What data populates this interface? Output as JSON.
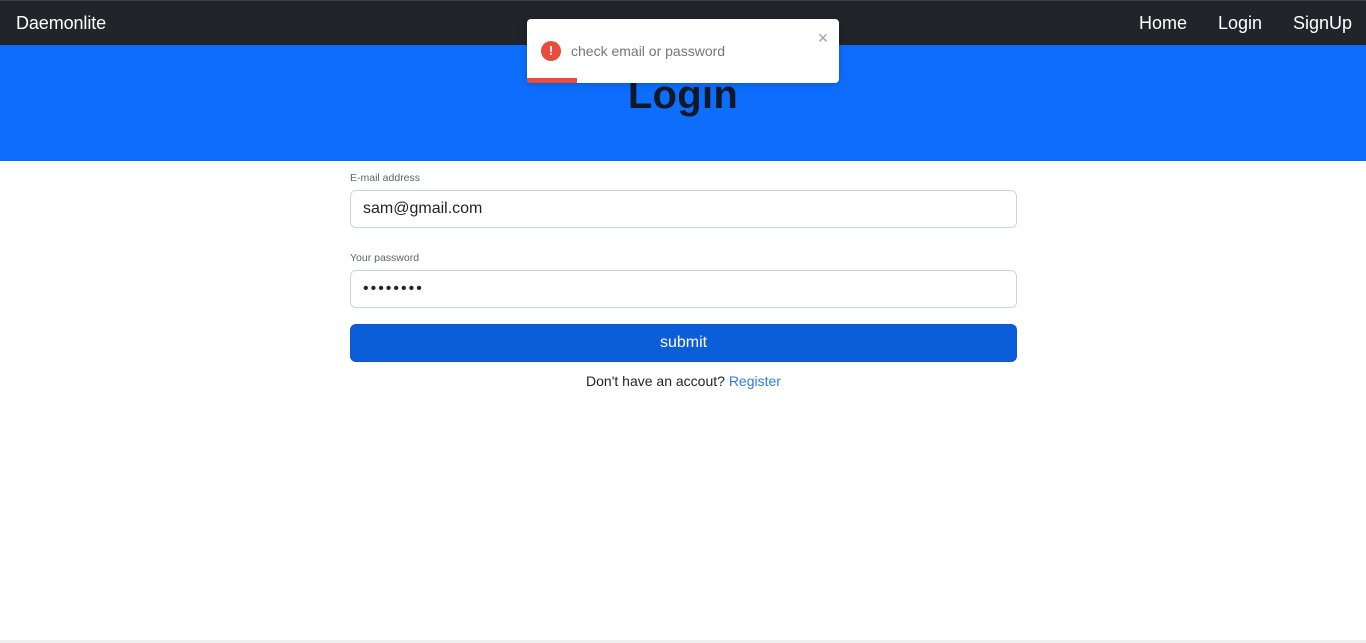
{
  "navbar": {
    "brand": "Daemonlite",
    "links": [
      "Home",
      "Login",
      "SignUp"
    ]
  },
  "hero": {
    "title": "Login"
  },
  "form": {
    "email_label": "E-mail address",
    "email_value": "sam@gmail.com",
    "password_label": "Your password",
    "password_value": "••••••••",
    "submit_label": "submit",
    "footer_prompt": "Don't have an accout?",
    "register_link": "Register"
  },
  "toast": {
    "type": "error",
    "icon": "exclamation-icon",
    "message": "check email or password",
    "close_icon": "close-icon",
    "progress": 0.16
  },
  "colors": {
    "navbar_bg": "#212529",
    "hero_bg": "#0d6efd",
    "button_bg": "#0b5ed7",
    "link": "#2b7de9",
    "error": "#e74c3c"
  }
}
